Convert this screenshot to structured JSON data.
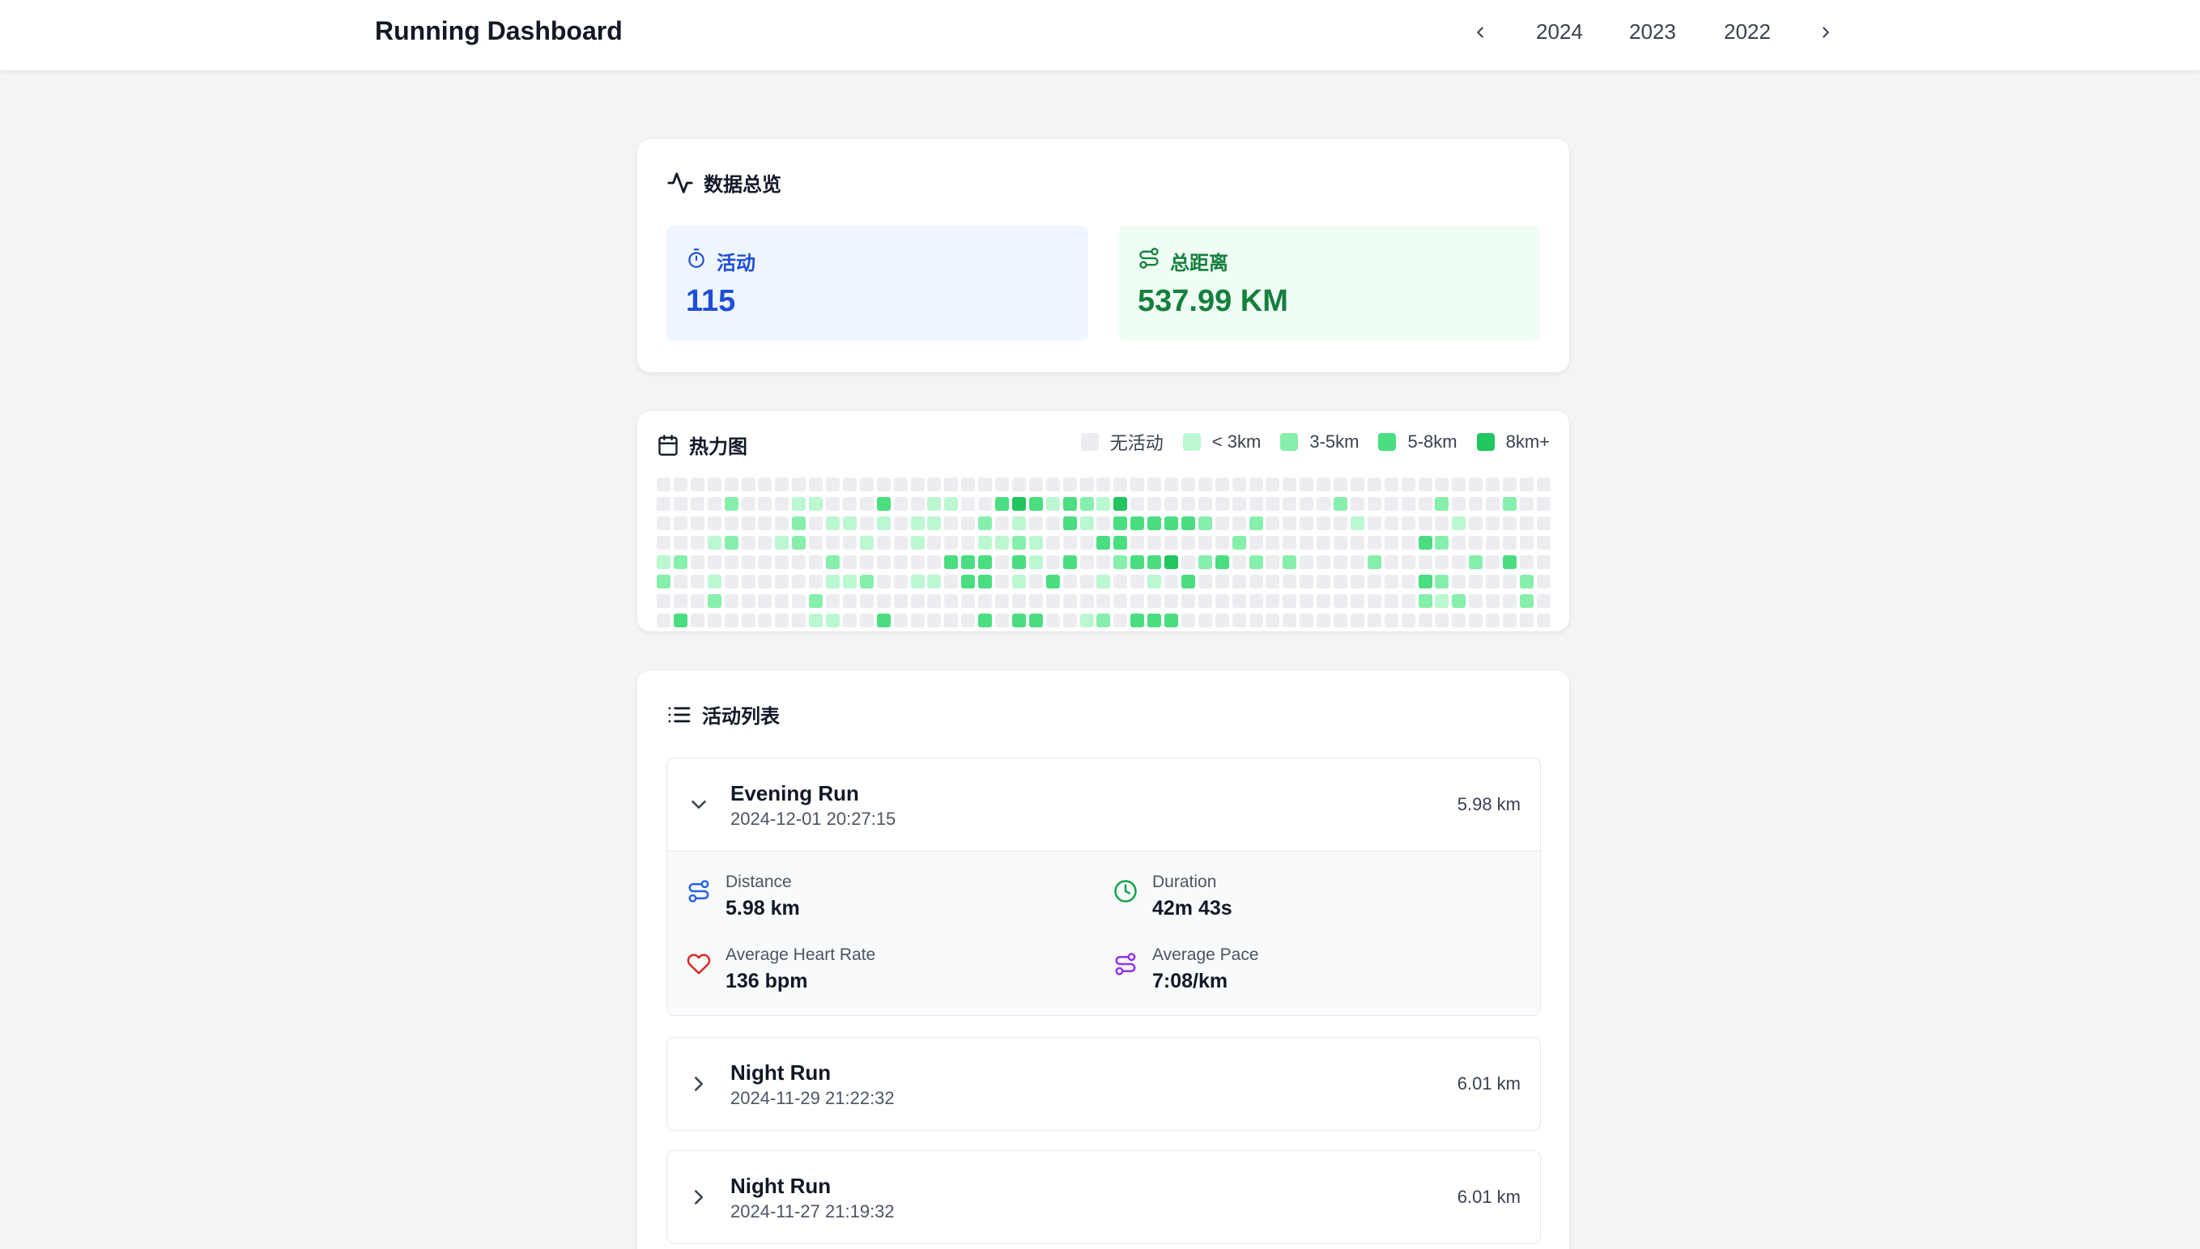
{
  "header": {
    "title": "Running Dashboard",
    "years": [
      "2024",
      "2023",
      "2022"
    ]
  },
  "overview": {
    "title": "数据总览",
    "activities_label": "活动",
    "activities_value": "115",
    "distance_label": "总距离",
    "distance_value": "537.99 KM"
  },
  "heatmap": {
    "title": "热力图",
    "legend": [
      "无活动",
      "< 3km",
      "3-5km",
      "5-8km",
      "8km+"
    ],
    "colors": [
      "#ebedf0",
      "#bbf7d0",
      "#86efac",
      "#4ade80",
      "#22c55e"
    ],
    "levels": [
      [
        0,
        0,
        0,
        0,
        0,
        0,
        0,
        0,
        0,
        0,
        0,
        0,
        0,
        0,
        0,
        0,
        0,
        0,
        0,
        0,
        0,
        0,
        0,
        0,
        0,
        0,
        0,
        0,
        0,
        0,
        0,
        0,
        0,
        0,
        0,
        0,
        0,
        0,
        0,
        0,
        0,
        0,
        0,
        0,
        0,
        0,
        0,
        0,
        0,
        0,
        0,
        0,
        0
      ],
      [
        0,
        0,
        0,
        0,
        2,
        0,
        0,
        0,
        1,
        1,
        0,
        0,
        0,
        3,
        0,
        0,
        1,
        1,
        0,
        0,
        3,
        4,
        3,
        1,
        3,
        2,
        1,
        4,
        0,
        0,
        0,
        0,
        0,
        0,
        0,
        0,
        0,
        0,
        0,
        0,
        2,
        0,
        0,
        0,
        0,
        0,
        2,
        0,
        0,
        0,
        2,
        0,
        0
      ],
      [
        0,
        0,
        0,
        0,
        0,
        0,
        0,
        0,
        2,
        0,
        1,
        1,
        0,
        1,
        0,
        1,
        1,
        0,
        0,
        2,
        0,
        1,
        0,
        0,
        3,
        1,
        0,
        3,
        3,
        3,
        3,
        3,
        2,
        0,
        0,
        2,
        0,
        0,
        0,
        0,
        0,
        1,
        0,
        0,
        0,
        0,
        0,
        1,
        0,
        0,
        0,
        0,
        0
      ],
      [
        0,
        0,
        0,
        1,
        2,
        0,
        0,
        1,
        2,
        0,
        0,
        0,
        1,
        0,
        0,
        1,
        0,
        0,
        0,
        1,
        1,
        2,
        1,
        0,
        0,
        0,
        3,
        3,
        0,
        0,
        0,
        0,
        0,
        0,
        2,
        0,
        0,
        0,
        0,
        0,
        0,
        0,
        0,
        0,
        0,
        3,
        2,
        0,
        0,
        0,
        0,
        0,
        0
      ],
      [
        1,
        2,
        0,
        0,
        0,
        0,
        0,
        0,
        0,
        0,
        2,
        0,
        0,
        0,
        0,
        0,
        0,
        3,
        3,
        3,
        0,
        3,
        1,
        0,
        3,
        0,
        0,
        2,
        3,
        3,
        4,
        0,
        2,
        3,
        0,
        2,
        0,
        2,
        0,
        0,
        0,
        0,
        2,
        0,
        0,
        0,
        0,
        0,
        2,
        0,
        3,
        0,
        0
      ],
      [
        2,
        0,
        0,
        1,
        0,
        0,
        0,
        0,
        0,
        0,
        1,
        1,
        2,
        0,
        0,
        1,
        1,
        0,
        3,
        3,
        0,
        1,
        0,
        3,
        0,
        0,
        1,
        0,
        0,
        1,
        0,
        3,
        0,
        0,
        0,
        0,
        0,
        0,
        0,
        0,
        0,
        0,
        0,
        0,
        0,
        3,
        2,
        0,
        0,
        0,
        0,
        2,
        0
      ],
      [
        0,
        0,
        0,
        2,
        0,
        0,
        0,
        0,
        0,
        2,
        0,
        0,
        0,
        0,
        0,
        0,
        0,
        0,
        0,
        0,
        0,
        0,
        0,
        0,
        0,
        0,
        0,
        0,
        0,
        0,
        0,
        0,
        0,
        0,
        0,
        0,
        0,
        0,
        0,
        0,
        0,
        0,
        0,
        0,
        0,
        2,
        1,
        2,
        0,
        0,
        0,
        2,
        0
      ],
      [
        0,
        3,
        0,
        0,
        0,
        0,
        0,
        0,
        0,
        1,
        1,
        0,
        0,
        3,
        0,
        0,
        0,
        0,
        0,
        3,
        0,
        3,
        3,
        0,
        0,
        1,
        2,
        0,
        3,
        3,
        3,
        0,
        0,
        0,
        0,
        0,
        0,
        0,
        0,
        0,
        0,
        0,
        0,
        0,
        0,
        0,
        0,
        0,
        0,
        0,
        0,
        0,
        0
      ]
    ]
  },
  "activities": {
    "title": "活动列表",
    "items": [
      {
        "name": "Evening Run",
        "date": "2024-12-01 20:27:15",
        "distance": "5.98 km",
        "expanded": true,
        "details": {
          "distance_label": "Distance",
          "distance_value": "5.98 km",
          "duration_label": "Duration",
          "duration_value": "42m 43s",
          "hr_label": "Average Heart Rate",
          "hr_value": "136 bpm",
          "pace_label": "Average Pace",
          "pace_value": "7:08/km"
        }
      },
      {
        "name": "Night Run",
        "date": "2024-11-29 21:22:32",
        "distance": "6.01 km",
        "expanded": false
      },
      {
        "name": "Night Run",
        "date": "2024-11-27 21:19:32",
        "distance": "6.01 km",
        "expanded": false
      }
    ]
  },
  "icons": {
    "header": [
      "chevron-left-icon",
      "chevron-right-icon"
    ],
    "overview": [
      "activity-pulse-icon",
      "timer-icon",
      "route-icon"
    ],
    "heatmap": [
      "calendar-icon"
    ],
    "activities": [
      "list-icon",
      "chevron-down-icon",
      "chevron-right-icon",
      "route-icon",
      "clock-icon",
      "heart-icon"
    ]
  }
}
